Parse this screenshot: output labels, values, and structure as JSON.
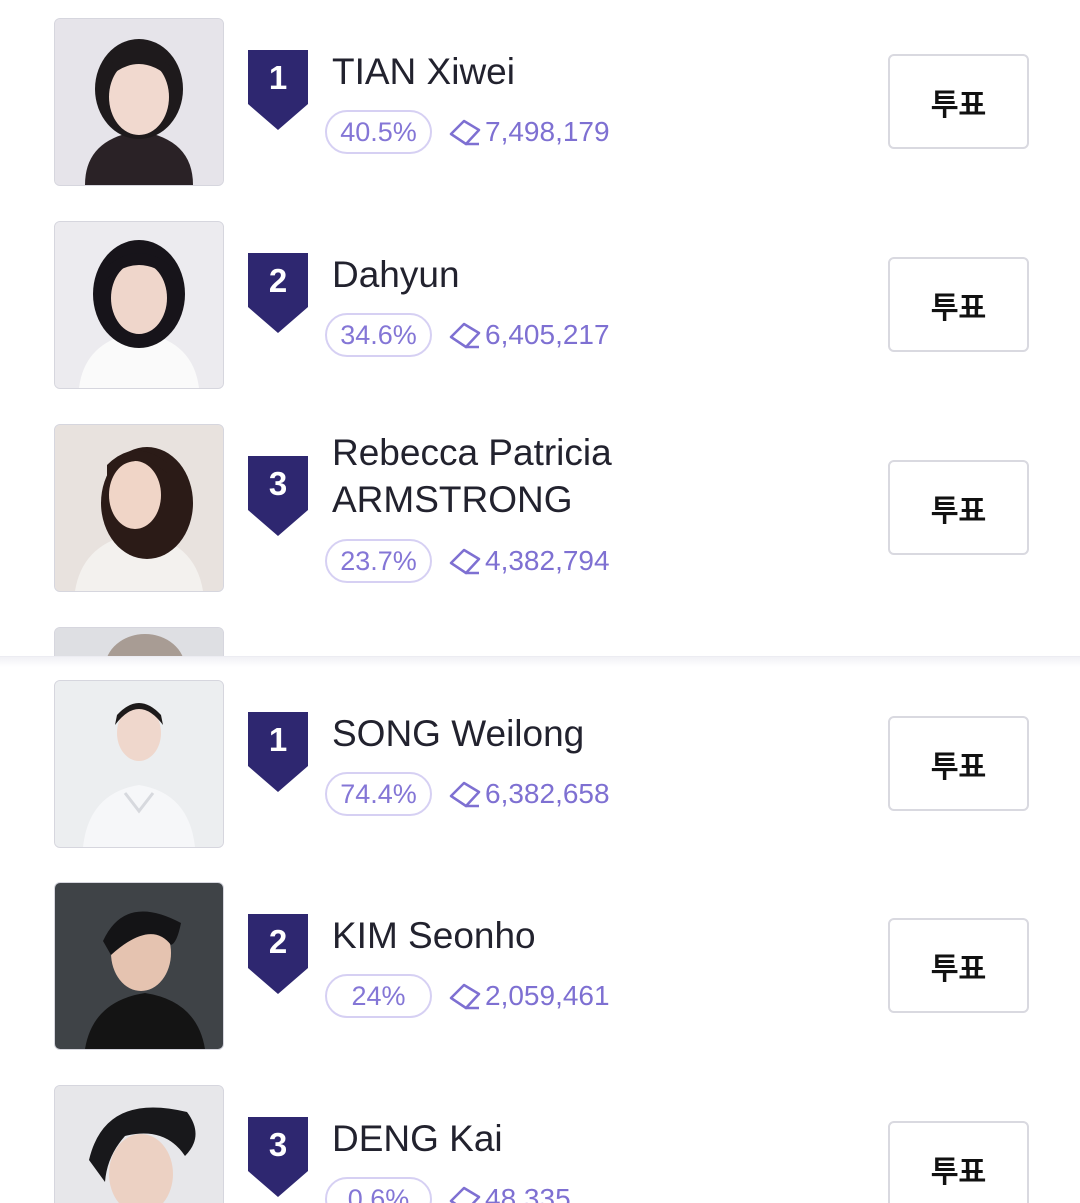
{
  "top_list": [
    {
      "rank": "1",
      "name": "TIAN Xiwei",
      "percent": "40.5%",
      "votes": "7,498,179",
      "vote_label": "투표"
    },
    {
      "rank": "2",
      "name": "Dahyun",
      "percent": "34.6%",
      "votes": "6,405,217",
      "vote_label": "투표"
    },
    {
      "rank": "3",
      "name": "Rebecca Patricia ARMSTRONG",
      "percent": "23.7%",
      "votes": "4,382,794",
      "vote_label": "투표"
    }
  ],
  "bottom_list": [
    {
      "rank": "1",
      "name": "SONG Weilong",
      "percent": "74.4%",
      "votes": "6,382,658",
      "vote_label": "투표"
    },
    {
      "rank": "2",
      "name": "KIM Seonho",
      "percent": "24%",
      "votes": "2,059,461",
      "vote_label": "투표"
    },
    {
      "rank": "3",
      "name": "DENG Kai",
      "percent": "0.6%",
      "votes": "48,335",
      "vote_label": "투표"
    }
  ],
  "icons": {
    "votes": "diamond-icon",
    "rank": "shield-badge-icon"
  },
  "colors": {
    "accent": "#2e2770",
    "percent": "#8476d6",
    "votes": "#7e70d2",
    "pill_border": "#d6d0f3"
  }
}
